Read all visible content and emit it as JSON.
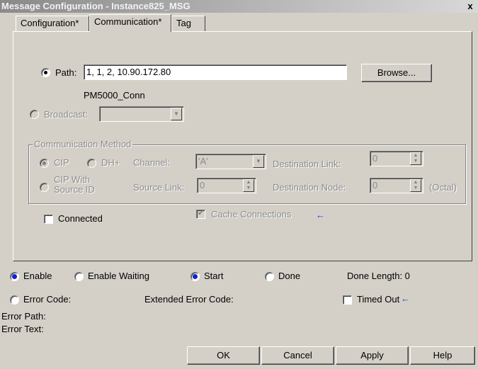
{
  "window": {
    "title": "Message Configuration - Instance825_MSG",
    "close_glyph": "x"
  },
  "tabs": [
    {
      "label": "Configuration*"
    },
    {
      "label": "Communication*"
    },
    {
      "label": "Tag"
    }
  ],
  "path": {
    "label": "Path:",
    "value": "1, 1, 2, 10.90.172.80",
    "browse_label": "Browse...",
    "connection_name": "PM5000_Conn"
  },
  "broadcast": {
    "label": "Broadcast:"
  },
  "comm_method": {
    "group_label": "Communication Method",
    "cip_label": "CIP",
    "dh_label": "DH+",
    "cip_with_label_line1": "CIP With",
    "cip_with_label_line2": "Source ID",
    "channel_label": "Channel:",
    "channel_value": "'A'",
    "source_link_label": "Source Link:",
    "source_link_value": "0",
    "dest_link_label": "Destination Link:",
    "dest_link_value": "0",
    "dest_node_label": "Destination Node:",
    "dest_node_value": "0",
    "octal_label": "(Octal)"
  },
  "options": {
    "connected_label": "Connected",
    "cache_label": "Cache Connections",
    "cache_arrow": "←"
  },
  "status": {
    "enable_label": "Enable",
    "enable_waiting_label": "Enable Waiting",
    "start_label": "Start",
    "done_label": "Done",
    "done_length": "Done Length: 0",
    "error_code_label": "Error Code:",
    "extended_error_label": "Extended Error Code:",
    "timed_out_label": "Timed Out",
    "timed_out_arrow": "←",
    "error_path_label": "Error Path:",
    "error_text_label": "Error Text:"
  },
  "buttons": {
    "ok": "OK",
    "cancel": "Cancel",
    "apply": "Apply",
    "help": "Help"
  },
  "colors": {
    "face": "#d4d0c8",
    "accent_blue": "#1a3cff"
  }
}
